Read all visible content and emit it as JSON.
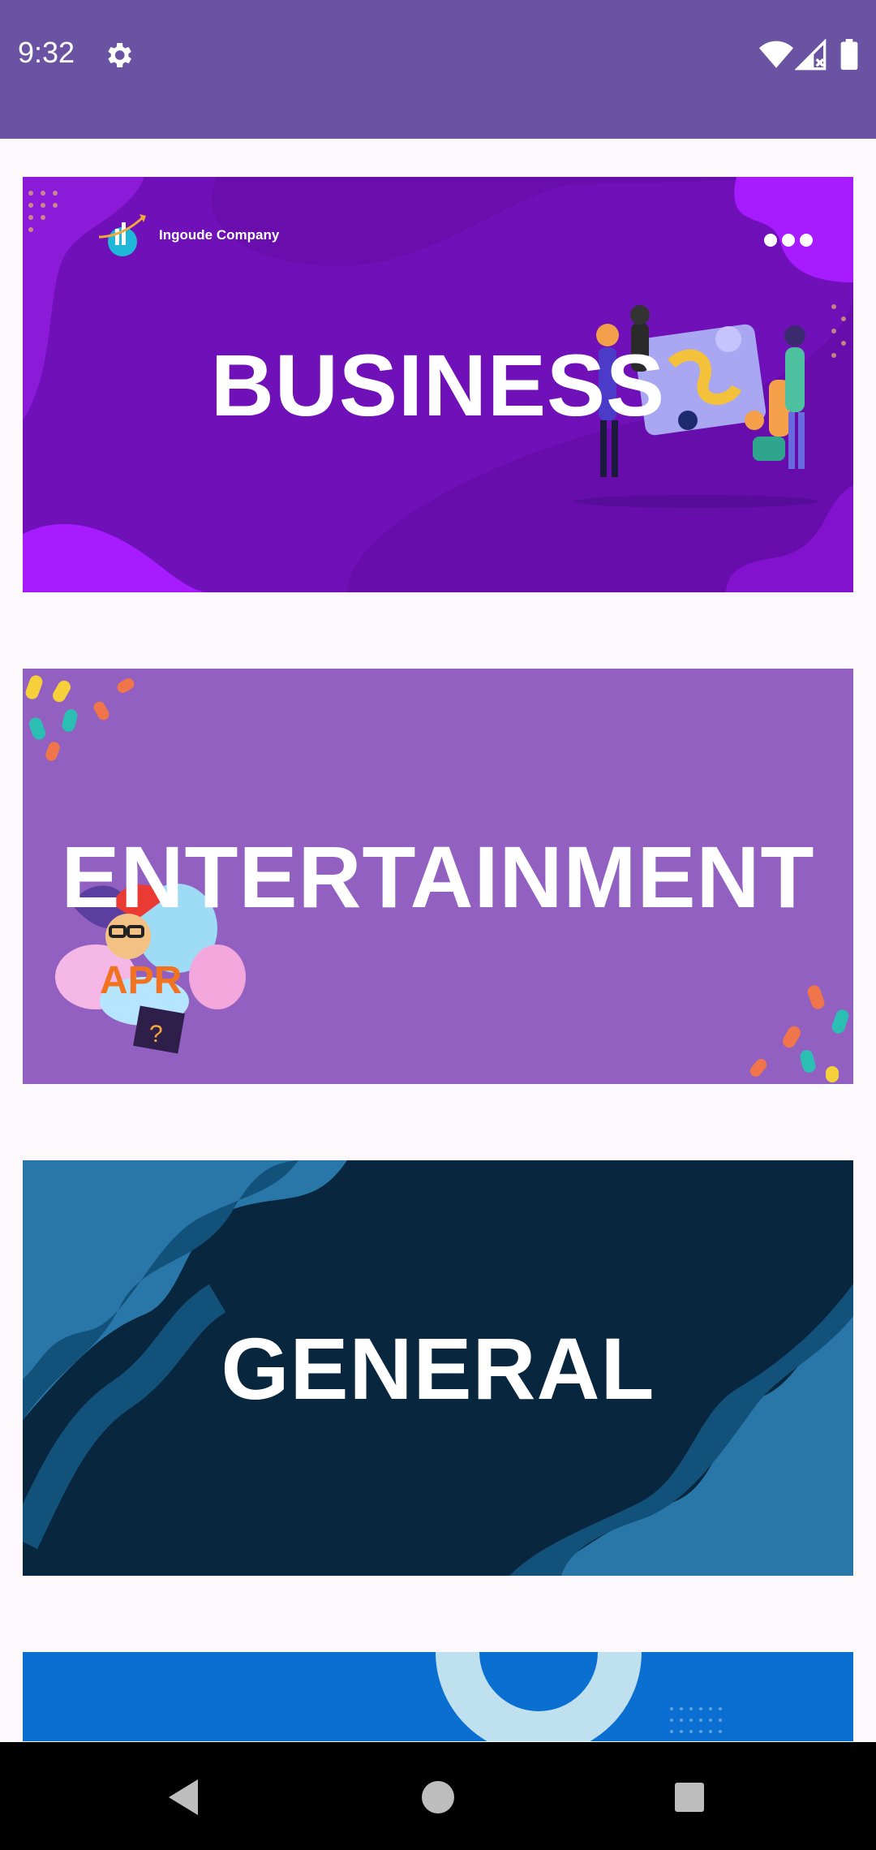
{
  "status_bar": {
    "time": "9:32",
    "icons": [
      "gear-icon",
      "wifi-icon",
      "signal-icon",
      "battery-icon"
    ],
    "background": "#6a53a2"
  },
  "cards": [
    {
      "title": "BUSINESS",
      "brand": "Ingoude Company",
      "background": "#6a0dad"
    },
    {
      "title": "ENTERTAINMENT",
      "background": "#9160c0"
    },
    {
      "title": "GENERAL",
      "background": "#08263d"
    },
    {
      "title": "",
      "background": "#0a6fd0"
    }
  ],
  "nav_bar": {
    "buttons": [
      "back-icon",
      "home-icon",
      "recents-icon"
    ]
  }
}
